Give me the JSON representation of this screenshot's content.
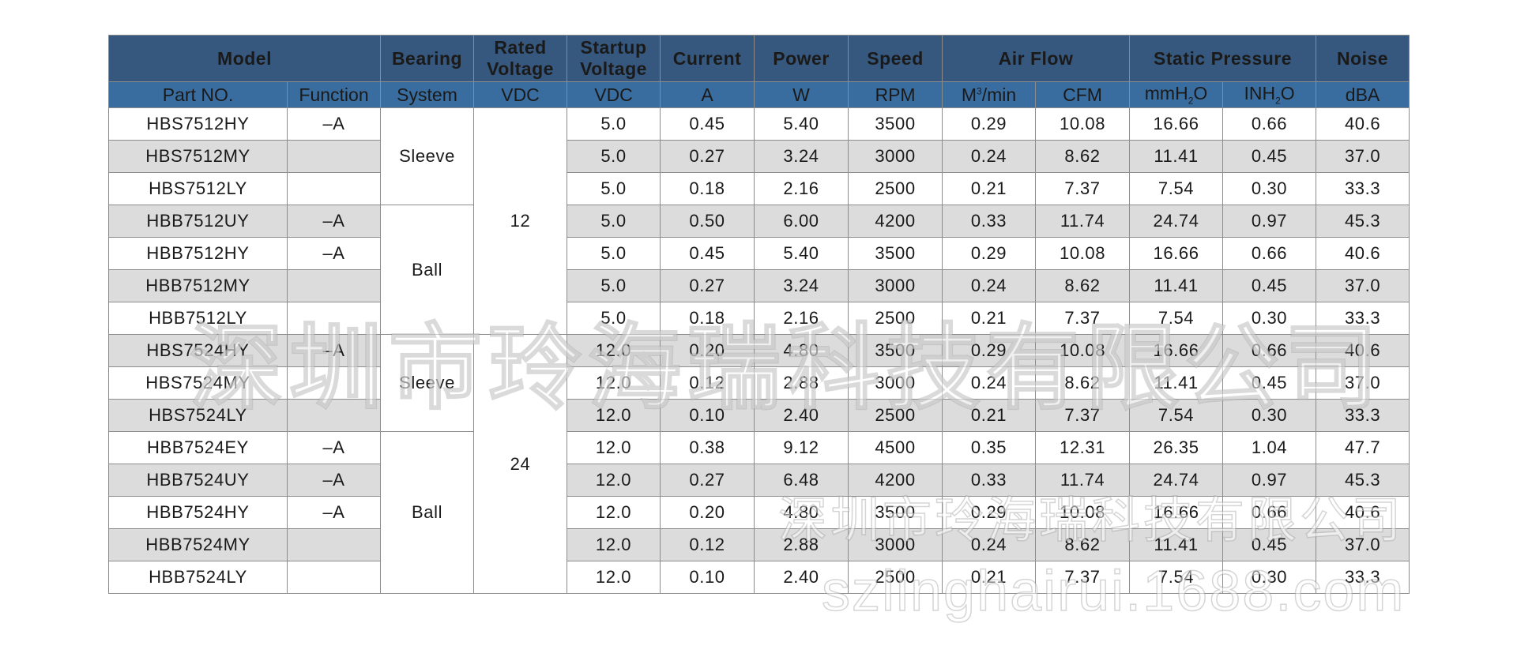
{
  "header": {
    "model": "Model",
    "bearing": "Bearing",
    "rated_voltage": "Rated\nVoltage",
    "startup_voltage": "Startup\nVoltage",
    "current": "Current",
    "power": "Power",
    "speed": "Speed",
    "air_flow": "Air Flow",
    "static_pressure": "Static Pressure",
    "noise": "Noise"
  },
  "subheader": {
    "part_no": "Part NO.",
    "function": "Function",
    "system": "System",
    "vdc_rated": "VDC",
    "vdc_startup": "VDC",
    "amp": "A",
    "watt": "W",
    "rpm": "RPM",
    "m3min_base": "M",
    "m3min_sup": "3",
    "m3min_tail": "/min",
    "cfm": "CFM",
    "mmh2o_base": "mmH",
    "mmh2o_sub": "2",
    "mmh2o_tail": "O",
    "inh2o_base": "INH",
    "inh2o_sub": "2",
    "inh2o_tail": "O",
    "dba": "dBA"
  },
  "bearing_groups": [
    "Sleeve",
    "Ball",
    "Sleeve",
    "Ball"
  ],
  "voltage_groups": [
    "12",
    "24"
  ],
  "rows": [
    {
      "part": "HBS7512HY",
      "func": "–A",
      "startup": "5.0",
      "current": "0.45",
      "power": "5.40",
      "speed": "3500",
      "m3": "0.29",
      "cfm": "10.08",
      "mmh2o": "16.66",
      "inh2o": "0.66",
      "dba": "40.6"
    },
    {
      "part": "HBS7512MY",
      "func": "",
      "startup": "5.0",
      "current": "0.27",
      "power": "3.24",
      "speed": "3000",
      "m3": "0.24",
      "cfm": "8.62",
      "mmh2o": "11.41",
      "inh2o": "0.45",
      "dba": "37.0"
    },
    {
      "part": "HBS7512LY",
      "func": "",
      "startup": "5.0",
      "current": "0.18",
      "power": "2.16",
      "speed": "2500",
      "m3": "0.21",
      "cfm": "7.37",
      "mmh2o": "7.54",
      "inh2o": "0.30",
      "dba": "33.3"
    },
    {
      "part": "HBB7512UY",
      "func": "–A",
      "startup": "5.0",
      "current": "0.50",
      "power": "6.00",
      "speed": "4200",
      "m3": "0.33",
      "cfm": "11.74",
      "mmh2o": "24.74",
      "inh2o": "0.97",
      "dba": "45.3"
    },
    {
      "part": "HBB7512HY",
      "func": "–A",
      "startup": "5.0",
      "current": "0.45",
      "power": "5.40",
      "speed": "3500",
      "m3": "0.29",
      "cfm": "10.08",
      "mmh2o": "16.66",
      "inh2o": "0.66",
      "dba": "40.6"
    },
    {
      "part": "HBB7512MY",
      "func": "",
      "startup": "5.0",
      "current": "0.27",
      "power": "3.24",
      "speed": "3000",
      "m3": "0.24",
      "cfm": "8.62",
      "mmh2o": "11.41",
      "inh2o": "0.45",
      "dba": "37.0"
    },
    {
      "part": "HBB7512LY",
      "func": "",
      "startup": "5.0",
      "current": "0.18",
      "power": "2.16",
      "speed": "2500",
      "m3": "0.21",
      "cfm": "7.37",
      "mmh2o": "7.54",
      "inh2o": "0.30",
      "dba": "33.3"
    },
    {
      "part": "HBS7524HY",
      "func": "–A",
      "startup": "12.0",
      "current": "0.20",
      "power": "4.80",
      "speed": "3500",
      "m3": "0.29",
      "cfm": "10.08",
      "mmh2o": "16.66",
      "inh2o": "0.66",
      "dba": "40.6"
    },
    {
      "part": "HBS7524MY",
      "func": "",
      "startup": "12.0",
      "current": "0.12",
      "power": "2.88",
      "speed": "3000",
      "m3": "0.24",
      "cfm": "8.62",
      "mmh2o": "11.41",
      "inh2o": "0.45",
      "dba": "37.0"
    },
    {
      "part": "HBS7524LY",
      "func": "",
      "startup": "12.0",
      "current": "0.10",
      "power": "2.40",
      "speed": "2500",
      "m3": "0.21",
      "cfm": "7.37",
      "mmh2o": "7.54",
      "inh2o": "0.30",
      "dba": "33.3"
    },
    {
      "part": "HBB7524EY",
      "func": "–A",
      "startup": "12.0",
      "current": "0.38",
      "power": "9.12",
      "speed": "4500",
      "m3": "0.35",
      "cfm": "12.31",
      "mmh2o": "26.35",
      "inh2o": "1.04",
      "dba": "47.7"
    },
    {
      "part": "HBB7524UY",
      "func": "–A",
      "startup": "12.0",
      "current": "0.27",
      "power": "6.48",
      "speed": "4200",
      "m3": "0.33",
      "cfm": "11.74",
      "mmh2o": "24.74",
      "inh2o": "0.97",
      "dba": "45.3"
    },
    {
      "part": "HBB7524HY",
      "func": "–A",
      "startup": "12.0",
      "current": "0.20",
      "power": "4.80",
      "speed": "3500",
      "m3": "0.29",
      "cfm": "10.08",
      "mmh2o": "16.66",
      "inh2o": "0.66",
      "dba": "40.6"
    },
    {
      "part": "HBB7524MY",
      "func": "",
      "startup": "12.0",
      "current": "0.12",
      "power": "2.88",
      "speed": "3000",
      "m3": "0.24",
      "cfm": "8.62",
      "mmh2o": "11.41",
      "inh2o": "0.45",
      "dba": "37.0"
    },
    {
      "part": "HBB7524LY",
      "func": "",
      "startup": "12.0",
      "current": "0.10",
      "power": "2.40",
      "speed": "2500",
      "m3": "0.21",
      "cfm": "7.37",
      "mmh2o": "7.54",
      "inh2o": "0.30",
      "dba": "33.3"
    }
  ],
  "watermark": {
    "company_large": "深圳市玲海瑞科技有限公司",
    "company_small": "深圳市玲海瑞科技有限公司",
    "url": "szlinghairui.1688.com"
  },
  "colors": {
    "header_dark": "#36587e",
    "header_sub": "#3a6d9f",
    "row_alt": "#dcdcdc"
  }
}
